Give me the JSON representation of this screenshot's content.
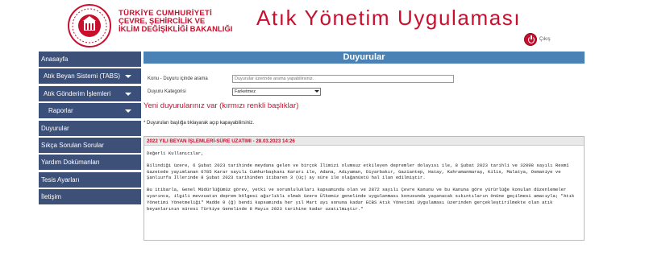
{
  "header": {
    "ministry_line1": "TÜRKİYE CUMHURİYETİ",
    "ministry_line2": "ÇEVRE, ŞEHİRCİLİK VE",
    "ministry_line3": "İKLİM DEĞİŞİKLİĞİ BAKANLIĞI",
    "app_title": "Atık Yönetim Uygulaması",
    "logout_label": "Çıkış"
  },
  "sidebar": {
    "items": [
      {
        "label": "Anasayfa"
      },
      {
        "label": "Atık Beyan Sistemi (TABS)"
      },
      {
        "label": "Atık Gönderim İşlemleri"
      },
      {
        "label": "Raporlar"
      },
      {
        "label": "Duyurular"
      },
      {
        "label": "Sıkça Sorulan Sorular"
      },
      {
        "label": "Yardım Dokümanları"
      },
      {
        "label": "Tesis Ayarları"
      },
      {
        "label": "İletişim"
      }
    ]
  },
  "main": {
    "title": "Duyurular",
    "search_label": "Konu - Duyuru içinde arama",
    "search_placeholder": "Duyurular üzerinde arama yapabilirsiniz.",
    "category_label": "Duyuru Kategorisi",
    "category_value": "Farketmez",
    "new_message": "Yeni duyurularınız var (kırmızı renkli başlıklar)",
    "hint": "* Duyuruları başlığa tıklayarak açıp kapayabilirsiniz."
  },
  "announcement": {
    "title": "2022 YILI BEYAN İŞLEMLERİ-SÜRE UZATIMI - 28.03.2023 14:26",
    "greeting": "Değerli Kullanıcılar,",
    "para1": "Bilindiği üzere, 6 Şubat 2023 tarihinde meydana gelen ve birçok İlimizi olumsuz etkileyen depremler dolayısı ile, 8 Şubat 2023 tarihli ve 32098 sayılı Resmî Gazetede yayımlanan 6785 Karar sayılı Cumhurbaşkanı Kararı ile, Adana, Adıyaman, Diyarbakır, Gaziantep, Hatay, Kahramanmaraş, Kilis, Malatya, Osmaniye ve Şanlıurfa İllerinde 8 Şubat 2023 tarihinden itibaren 3 (üç) ay süre ile olağanüstü hal ilan edilmiştir.",
    "para2": "Bu itibarla, Genel Müdürlüğümüz görev, yetki ve sorumlulukları kapsamında olan ve 2872 sayılı Çevre Kanunu ve bu Kanuna göre yürürlüğe konulan düzenlemeler uyarınca, ilgili mevzuatın deprem bölgesi ağırlıklı olmak üzere Ülkemiz genelinde uygulanması konusunda yaşanacak sıkıntıların önüne geçilmesi amacıyla; \"Atık Yönetimi Yönetmeliği\" Madde 9 (ğ) bendi kapsamında her yıl Mart ayı sonuna kadar ECBS Atık Yönetimi Uygulaması üzerinden gerçekleştirilmekte olan atık beyanlarının süresi Türkiye Genelinde 8 Mayıs 2023 tarihine kadar uzatılmıştır.\""
  },
  "colors": {
    "brand_red": "#c8102e",
    "sidebar_bg": "#3a4f7a",
    "panel_title_bg": "#4a82b5"
  }
}
